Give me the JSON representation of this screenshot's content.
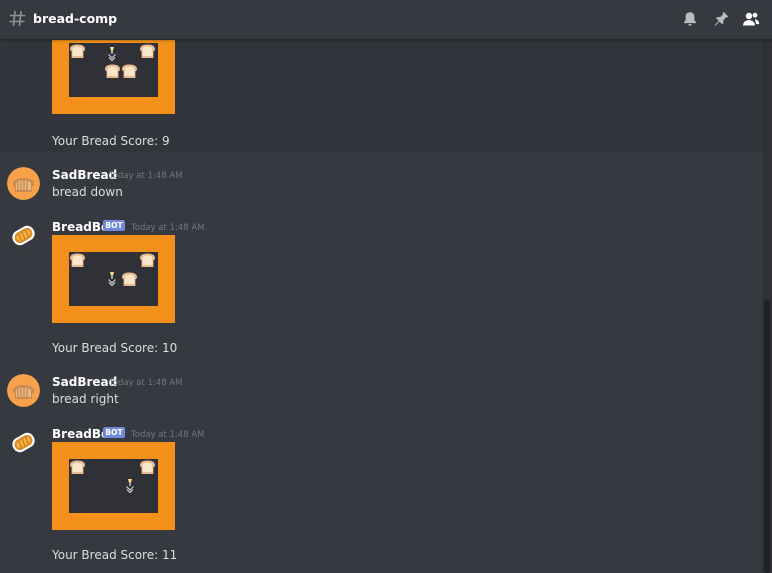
{
  "channel": {
    "name": "bread-comp"
  },
  "colors": {
    "background": "#36393f",
    "grid_border": "#f39019",
    "grid_inner": "#2f3136",
    "bot_tag": "#7289da",
    "timestamp": "#72767d"
  },
  "icons": [
    "hash-icon",
    "bell-icon",
    "pin-icon",
    "members-icon",
    "bread-avatar-icon",
    "toast-avatar-icon",
    "bread-slice-icon",
    "goal-marker-icon"
  ],
  "messages": [
    {
      "type": "bot-output",
      "grid": "top",
      "score_text": "Your Bread Score: 9"
    },
    {
      "type": "user",
      "author": "SadBread",
      "timestamp": "Today at 1:48 AM",
      "text": "bread down"
    },
    {
      "type": "bot",
      "author": "BreadBoi",
      "bot_tag": "BOT",
      "timestamp": "Today at 1:48 AM",
      "score_text": "Your Bread Score: 10"
    },
    {
      "type": "user",
      "author": "SadBread",
      "timestamp": "Today at 1:48 AM",
      "text": "bread right"
    },
    {
      "type": "bot",
      "author": "BreadBoi",
      "bot_tag": "BOT",
      "timestamp": "Today at 1:48 AM",
      "score_text": "Your Bread Score: 11"
    }
  ]
}
